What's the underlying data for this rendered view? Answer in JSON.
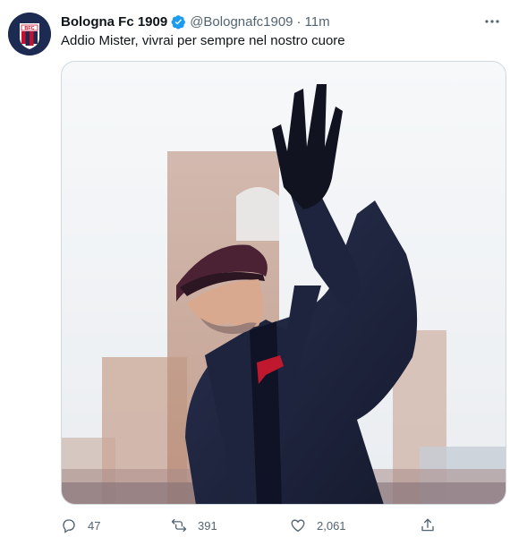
{
  "tweet": {
    "author": {
      "name": "Bologna Fc 1909",
      "handle": "@Bolognafc1909",
      "avatar_icon": "bologna-crest-icon",
      "verified_icon": "verified-badge-icon",
      "avatar_letters": "BFC"
    },
    "separator": "·",
    "time": "11m",
    "more_icon": "more-horizontal-icon",
    "more_label": "···",
    "text": "Addio Mister, vivrai per sempre nel nostro cuore",
    "media": {
      "alt_icon": "photo-man-waving"
    },
    "actions": {
      "reply": {
        "icon": "reply-icon",
        "count": "47"
      },
      "retweet": {
        "icon": "retweet-icon",
        "count": "391"
      },
      "like": {
        "icon": "like-icon",
        "count": "2,061"
      },
      "share": {
        "icon": "share-icon"
      }
    },
    "colors": {
      "verified": "#1d9bf0",
      "muted": "#536471",
      "text": "#0f1419"
    }
  }
}
